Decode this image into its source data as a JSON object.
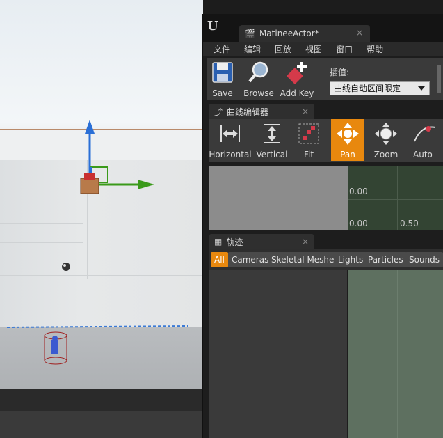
{
  "editor": {
    "tab_title": "MatineeActor*",
    "tab_close": "×",
    "logo": "U",
    "menu": [
      "文件",
      "编辑",
      "回放",
      "视图",
      "窗口",
      "帮助"
    ],
    "toolbar": {
      "save": "Save",
      "browse": "Browse",
      "add_key": "Add Key",
      "interp_label": "插值:",
      "interp_value": "曲线自动区间限定"
    }
  },
  "curve_editor": {
    "tab_title": "曲线编辑器",
    "tab_close": "×",
    "buttons": [
      "Horizontal",
      "Vertical",
      "Fit",
      "Pan",
      "Zoom",
      "Auto"
    ],
    "active_button": "Pan",
    "graph_labels": {
      "top_left": "0.00",
      "bottom_left": "0.00",
      "bottom_right": "0.50"
    }
  },
  "tracks": {
    "tab_title": "轨迹",
    "tab_close": "×",
    "filters": [
      "All",
      "Cameras",
      "Skeletal Meshes",
      "Lights",
      "Particles",
      "Sounds"
    ],
    "active_filter": "All"
  },
  "colors": {
    "accent": "#e8880e",
    "graph_bg": "#334433",
    "tracks_bg": "#5e7060",
    "gizmo_z": "#2a6fd6",
    "gizmo_y": "#3a9a1a"
  }
}
